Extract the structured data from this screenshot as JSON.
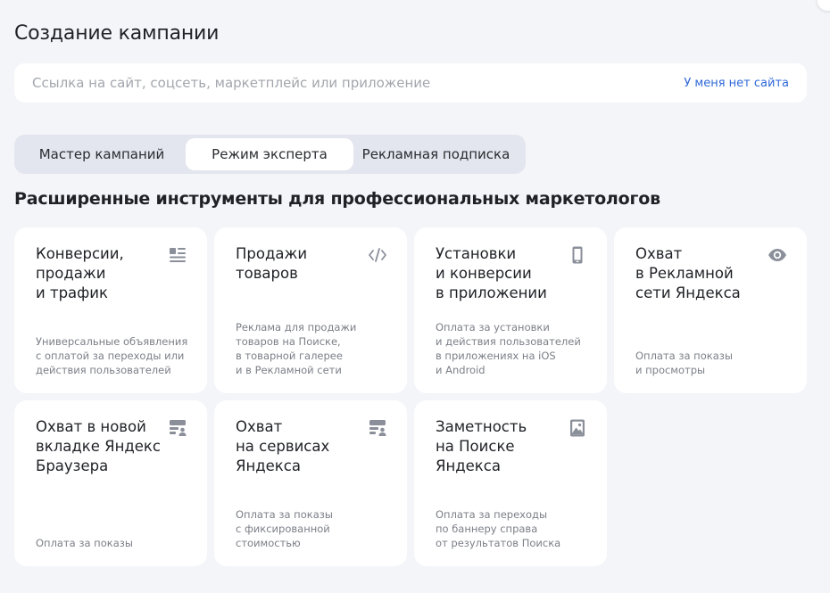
{
  "page": {
    "title": "Создание кампании"
  },
  "url_bar": {
    "placeholder": "Ссылка на сайт, соцсеть, маркетплейс или приложение",
    "no_site_link": "У меня нет сайта"
  },
  "mode_tabs": [
    {
      "label": "Мастер кампаний",
      "selected": false
    },
    {
      "label": "Режим эксперта",
      "selected": true
    },
    {
      "label": "Рекламная подписка",
      "selected": false
    }
  ],
  "section": {
    "title": "Расширенные инструменты для профессиональных маркетологов"
  },
  "cards": [
    {
      "title": "Конверсии,\nпродажи\nи трафик",
      "desc": "Универсальные объявления\nс оплатой за переходы или\nдействия пользователей",
      "icon": "list-icon"
    },
    {
      "title": "Продажи\nтоваров",
      "desc": "Реклама для продажи\nтоваров на Поиске,\nв товарной галерее\nи в Рекламной сети",
      "icon": "code-icon"
    },
    {
      "title": "Установки\nи конверсии\nв приложении",
      "desc": "Оплата за установки\nи действия пользователей\nв приложениях на iOS\nи Android",
      "icon": "smartphone-icon"
    },
    {
      "title": "Охват\nв Рекламной\nсети Яндекса",
      "desc": "Оплата за показы\nи просмотры",
      "icon": "eye-icon"
    },
    {
      "title": "Охват в новой\nвкладке Яндекс\nБраузера",
      "desc": "Оплата за показы",
      "icon": "banner-user-icon"
    },
    {
      "title": "Охват\nна сервисах\nЯндекса",
      "desc": "Оплата за показы\nс фиксированной\nстоимостью",
      "icon": "banner-user-icon"
    },
    {
      "title": "Заметность\nна Поиске\nЯндекса",
      "desc": "Оплата за переходы\nпо баннеру справа\nот результатов Поиска",
      "icon": "image-icon"
    }
  ],
  "colors": {
    "background": "#f4f5f9",
    "card": "#ffffff",
    "link": "#2f68d8",
    "icon": "#8a8f99",
    "muted_text": "#7b7f87"
  }
}
